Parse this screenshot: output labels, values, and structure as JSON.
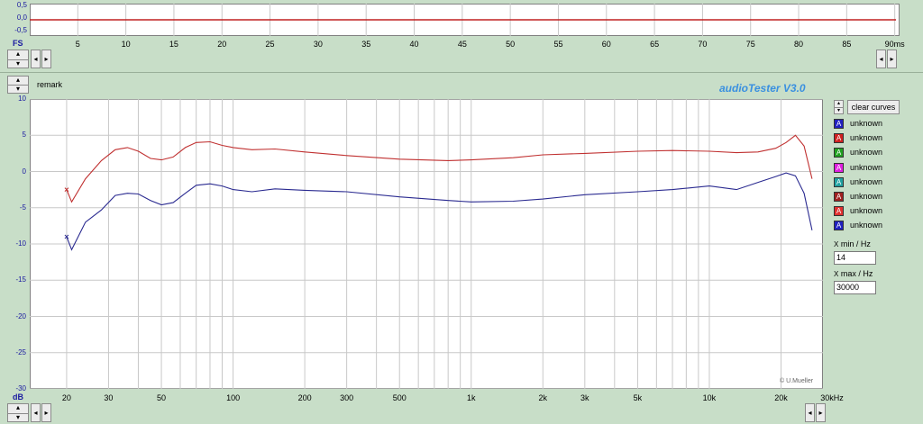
{
  "top_panel": {
    "y_labels": [
      "0,5",
      "0,0",
      "-0,5"
    ],
    "unit_label": "FS",
    "x_labels": [
      "5",
      "10",
      "15",
      "20",
      "25",
      "30",
      "35",
      "40",
      "45",
      "50",
      "55",
      "60",
      "65",
      "70",
      "75",
      "80",
      "85",
      "90ms"
    ]
  },
  "remark_label": "remark",
  "brand": "audioTester  V3.0",
  "copyright": "© U.Mueller",
  "clear_button": "clear curves",
  "legend": [
    {
      "glyph": "A",
      "label": "unknown",
      "color": "#2020c0"
    },
    {
      "glyph": "A",
      "label": "unknown",
      "color": "#d02020"
    },
    {
      "glyph": "A",
      "label": "unknown",
      "color": "#20a020"
    },
    {
      "glyph": "A",
      "label": "unknown",
      "color": "#e020e0"
    },
    {
      "glyph": "A",
      "label": "unknown",
      "color": "#20a0a0"
    },
    {
      "glyph": "A",
      "label": "unknown",
      "color": "#a02020"
    },
    {
      "glyph": "A",
      "label": "unknown",
      "color": "#e03030"
    },
    {
      "glyph": "A",
      "label": "unknown",
      "color": "#2020c0"
    }
  ],
  "x_min": {
    "label": "min / Hz",
    "x": "X",
    "value": "14"
  },
  "x_max": {
    "label": "max / Hz",
    "x": "X",
    "value": "30000"
  },
  "main_panel": {
    "y_labels": [
      "10",
      "5",
      "0",
      "-5",
      "-10",
      "-15",
      "-20",
      "-25",
      "-30"
    ],
    "unit_label": "dB",
    "x_labels": [
      "20",
      "30",
      "50",
      "100",
      "200",
      "300",
      "500",
      "1k",
      "2k",
      "3k",
      "5k",
      "10k",
      "20k",
      "30kHz"
    ]
  },
  "chart_data": {
    "type": "line",
    "x_scale": "log",
    "xlim": [
      14,
      30000
    ],
    "ylim": [
      -30,
      10
    ],
    "ylabel": "dB",
    "xlabel": "Hz",
    "grid": true,
    "series": [
      {
        "color": "#c03030",
        "x": [
          20,
          21,
          24,
          28,
          32,
          36,
          40,
          45,
          50,
          56,
          63,
          70,
          80,
          90,
          100,
          120,
          150,
          200,
          300,
          500,
          800,
          1000,
          1500,
          2000,
          3000,
          5000,
          7000,
          10000,
          13000,
          16000,
          19000,
          21000,
          23000,
          25000,
          27000
        ],
        "y": [
          -2.5,
          -4.2,
          -1,
          1.5,
          3,
          3.3,
          2.8,
          1.8,
          1.6,
          2,
          3.3,
          4,
          4.1,
          3.6,
          3.3,
          3,
          3.1,
          2.7,
          2.2,
          1.7,
          1.5,
          1.6,
          1.9,
          2.3,
          2.5,
          2.8,
          2.9,
          2.8,
          2.6,
          2.7,
          3.2,
          4,
          5,
          3.5,
          -1
        ]
      },
      {
        "color": "#2a2a90",
        "x": [
          20,
          21,
          24,
          28,
          32,
          36,
          40,
          45,
          50,
          56,
          63,
          70,
          80,
          90,
          100,
          120,
          150,
          200,
          300,
          500,
          800,
          1000,
          1500,
          2000,
          3000,
          5000,
          7000,
          10000,
          13000,
          16000,
          19000,
          21000,
          23000,
          25000,
          27000
        ],
        "y": [
          -9,
          -10.8,
          -7,
          -5.3,
          -3.3,
          -3,
          -3.1,
          -4,
          -4.6,
          -4.3,
          -3,
          -1.9,
          -1.7,
          -2,
          -2.5,
          -2.8,
          -2.4,
          -2.6,
          -2.8,
          -3.5,
          -4,
          -4.2,
          -4.1,
          -3.8,
          -3.2,
          -2.8,
          -2.5,
          -2,
          -2.5,
          -1.5,
          -0.7,
          -0.2,
          -0.6,
          -3,
          -8.1
        ]
      }
    ]
  }
}
